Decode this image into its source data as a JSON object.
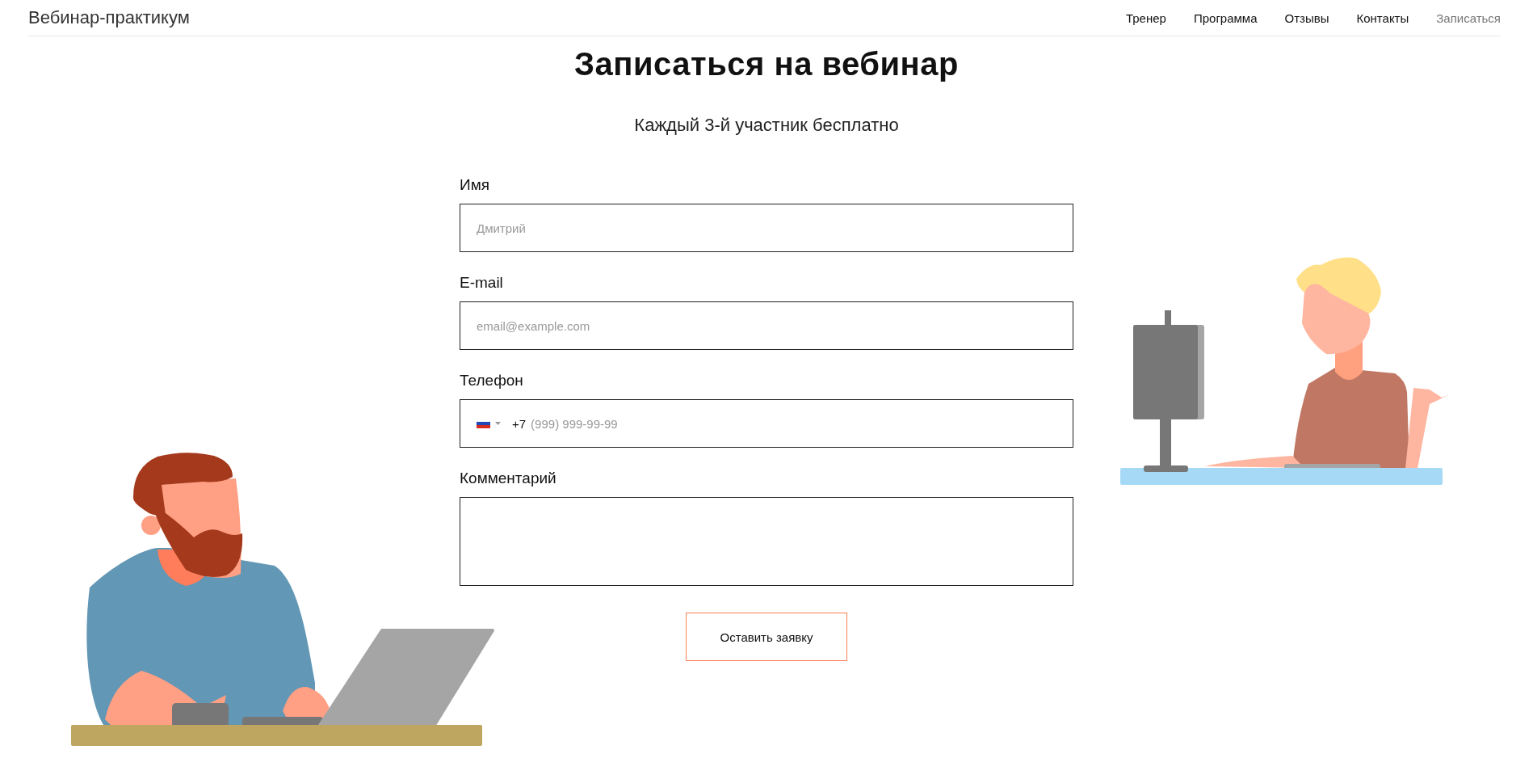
{
  "site_title": "Вебинар-практикум",
  "nav": [
    {
      "label": "Тренер",
      "selected": false
    },
    {
      "label": "Программа",
      "selected": false
    },
    {
      "label": "Отзывы",
      "selected": false
    },
    {
      "label": "Контакты",
      "selected": false
    },
    {
      "label": "Записаться",
      "selected": true
    }
  ],
  "heading": "Записаться на вебинар",
  "subtitle": "Каждый 3-й участник бесплатно",
  "fields": [
    {
      "kind": "text",
      "label": "Имя",
      "placeholder": "Дмитрий"
    },
    {
      "kind": "email",
      "label": "E-mail",
      "placeholder": "email@example.com"
    },
    {
      "kind": "phone",
      "label": "Телефон",
      "country_code": "+7",
      "placeholder": "(999) 999-99-99"
    },
    {
      "kind": "textarea",
      "label": "Комментарий"
    }
  ],
  "submit_button": "Оставить заявку"
}
